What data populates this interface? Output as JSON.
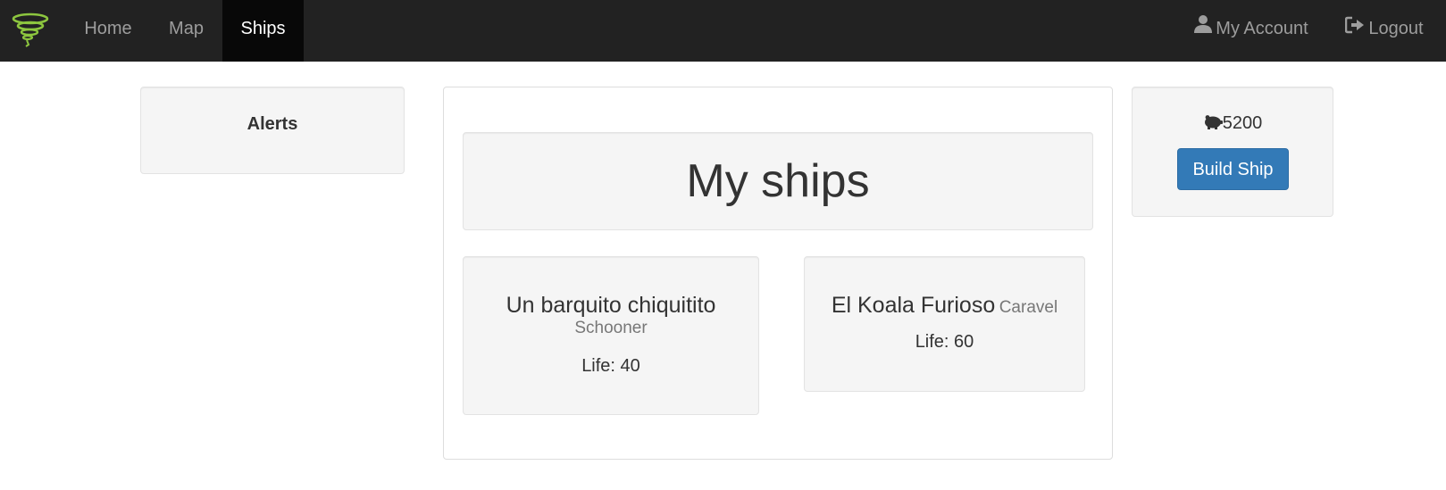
{
  "navbar": {
    "logo_icon": "tornado-logo-icon",
    "items": [
      {
        "label": "Home"
      },
      {
        "label": "Map"
      },
      {
        "label": "Ships",
        "active": true
      }
    ],
    "account_label": "My Account",
    "account_icon": "user-icon",
    "logout_label": "Logout",
    "logout_icon": "logout-icon"
  },
  "alerts": {
    "title": "Alerts"
  },
  "main": {
    "title": "My ships",
    "ships": [
      {
        "name": "Un barquito chiquitito",
        "type": "Schooner",
        "life": "Life: 40"
      },
      {
        "name": "El Koala Furioso",
        "type": "Caravel",
        "life": "Life: 60"
      }
    ]
  },
  "resources": {
    "icon": "piggy-bank-icon",
    "coins": "5200",
    "build_button": "Build Ship"
  },
  "colors": {
    "navbar_bg": "#222222",
    "nav_active_bg": "#080808",
    "primary_button": "#337ab7",
    "logo": "#8dc63f"
  }
}
